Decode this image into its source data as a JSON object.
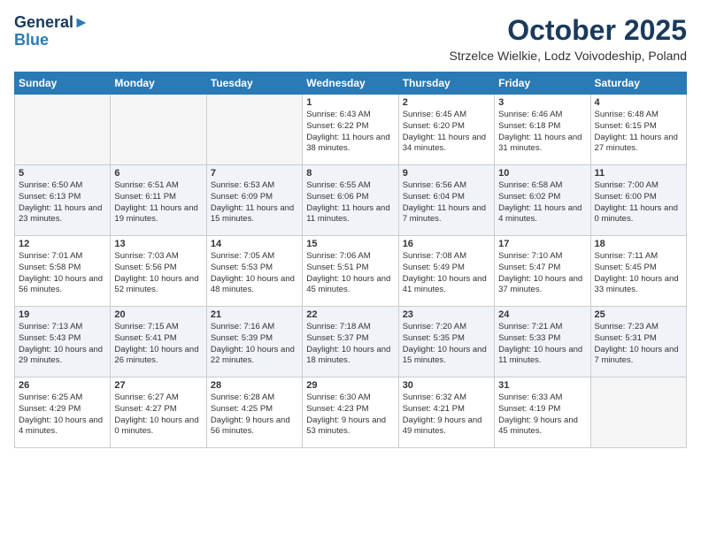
{
  "header": {
    "logo_line1": "General",
    "logo_line2": "Blue",
    "month": "October 2025",
    "location": "Strzelce Wielkie, Lodz Voivodeship, Poland"
  },
  "weekdays": [
    "Sunday",
    "Monday",
    "Tuesday",
    "Wednesday",
    "Thursday",
    "Friday",
    "Saturday"
  ],
  "weeks": [
    [
      {
        "day": "",
        "empty": true
      },
      {
        "day": "",
        "empty": true
      },
      {
        "day": "",
        "empty": true
      },
      {
        "day": "1",
        "sunrise": "6:43 AM",
        "sunset": "6:22 PM",
        "daylight": "11 hours and 38 minutes."
      },
      {
        "day": "2",
        "sunrise": "6:45 AM",
        "sunset": "6:20 PM",
        "daylight": "11 hours and 34 minutes."
      },
      {
        "day": "3",
        "sunrise": "6:46 AM",
        "sunset": "6:18 PM",
        "daylight": "11 hours and 31 minutes."
      },
      {
        "day": "4",
        "sunrise": "6:48 AM",
        "sunset": "6:15 PM",
        "daylight": "11 hours and 27 minutes."
      }
    ],
    [
      {
        "day": "5",
        "sunrise": "6:50 AM",
        "sunset": "6:13 PM",
        "daylight": "11 hours and 23 minutes."
      },
      {
        "day": "6",
        "sunrise": "6:51 AM",
        "sunset": "6:11 PM",
        "daylight": "11 hours and 19 minutes."
      },
      {
        "day": "7",
        "sunrise": "6:53 AM",
        "sunset": "6:09 PM",
        "daylight": "11 hours and 15 minutes."
      },
      {
        "day": "8",
        "sunrise": "6:55 AM",
        "sunset": "6:06 PM",
        "daylight": "11 hours and 11 minutes."
      },
      {
        "day": "9",
        "sunrise": "6:56 AM",
        "sunset": "6:04 PM",
        "daylight": "11 hours and 7 minutes."
      },
      {
        "day": "10",
        "sunrise": "6:58 AM",
        "sunset": "6:02 PM",
        "daylight": "11 hours and 4 minutes."
      },
      {
        "day": "11",
        "sunrise": "7:00 AM",
        "sunset": "6:00 PM",
        "daylight": "11 hours and 0 minutes."
      }
    ],
    [
      {
        "day": "12",
        "sunrise": "7:01 AM",
        "sunset": "5:58 PM",
        "daylight": "10 hours and 56 minutes."
      },
      {
        "day": "13",
        "sunrise": "7:03 AM",
        "sunset": "5:56 PM",
        "daylight": "10 hours and 52 minutes."
      },
      {
        "day": "14",
        "sunrise": "7:05 AM",
        "sunset": "5:53 PM",
        "daylight": "10 hours and 48 minutes."
      },
      {
        "day": "15",
        "sunrise": "7:06 AM",
        "sunset": "5:51 PM",
        "daylight": "10 hours and 45 minutes."
      },
      {
        "day": "16",
        "sunrise": "7:08 AM",
        "sunset": "5:49 PM",
        "daylight": "10 hours and 41 minutes."
      },
      {
        "day": "17",
        "sunrise": "7:10 AM",
        "sunset": "5:47 PM",
        "daylight": "10 hours and 37 minutes."
      },
      {
        "day": "18",
        "sunrise": "7:11 AM",
        "sunset": "5:45 PM",
        "daylight": "10 hours and 33 minutes."
      }
    ],
    [
      {
        "day": "19",
        "sunrise": "7:13 AM",
        "sunset": "5:43 PM",
        "daylight": "10 hours and 29 minutes."
      },
      {
        "day": "20",
        "sunrise": "7:15 AM",
        "sunset": "5:41 PM",
        "daylight": "10 hours and 26 minutes."
      },
      {
        "day": "21",
        "sunrise": "7:16 AM",
        "sunset": "5:39 PM",
        "daylight": "10 hours and 22 minutes."
      },
      {
        "day": "22",
        "sunrise": "7:18 AM",
        "sunset": "5:37 PM",
        "daylight": "10 hours and 18 minutes."
      },
      {
        "day": "23",
        "sunrise": "7:20 AM",
        "sunset": "5:35 PM",
        "daylight": "10 hours and 15 minutes."
      },
      {
        "day": "24",
        "sunrise": "7:21 AM",
        "sunset": "5:33 PM",
        "daylight": "10 hours and 11 minutes."
      },
      {
        "day": "25",
        "sunrise": "7:23 AM",
        "sunset": "5:31 PM",
        "daylight": "10 hours and 7 minutes."
      }
    ],
    [
      {
        "day": "26",
        "sunrise": "6:25 AM",
        "sunset": "4:29 PM",
        "daylight": "10 hours and 4 minutes."
      },
      {
        "day": "27",
        "sunrise": "6:27 AM",
        "sunset": "4:27 PM",
        "daylight": "10 hours and 0 minutes."
      },
      {
        "day": "28",
        "sunrise": "6:28 AM",
        "sunset": "4:25 PM",
        "daylight": "9 hours and 56 minutes."
      },
      {
        "day": "29",
        "sunrise": "6:30 AM",
        "sunset": "4:23 PM",
        "daylight": "9 hours and 53 minutes."
      },
      {
        "day": "30",
        "sunrise": "6:32 AM",
        "sunset": "4:21 PM",
        "daylight": "9 hours and 49 minutes."
      },
      {
        "day": "31",
        "sunrise": "6:33 AM",
        "sunset": "4:19 PM",
        "daylight": "9 hours and 45 minutes."
      },
      {
        "day": "",
        "empty": true
      }
    ]
  ],
  "labels": {
    "sunrise_prefix": "Sunrise: ",
    "sunset_prefix": "Sunset: ",
    "daylight_prefix": "Daylight: "
  }
}
